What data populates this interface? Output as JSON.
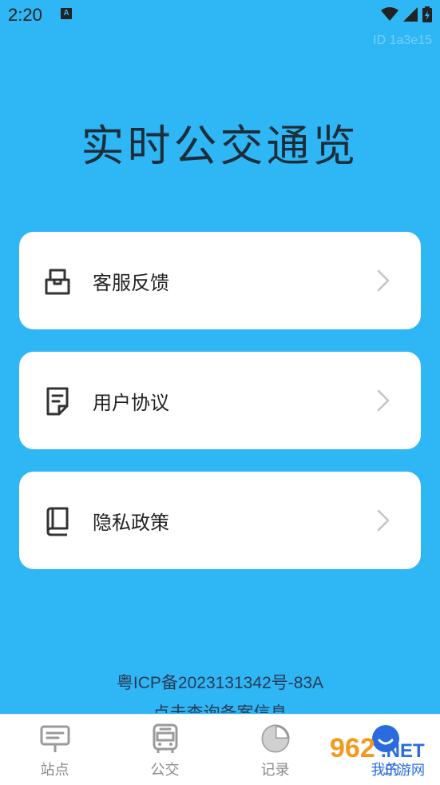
{
  "status_bar": {
    "time": "2:20",
    "badge": "A",
    "icons": [
      "wifi-icon",
      "signal-icon",
      "battery-charging-icon"
    ]
  },
  "id_text": "ID 1a3e15",
  "app_title": "实时公交通览",
  "menu": [
    {
      "label": "客服反馈",
      "icon": "mailbox-icon"
    },
    {
      "label": "用户协议",
      "icon": "document-icon"
    },
    {
      "label": "隐私政策",
      "icon": "book-icon"
    }
  ],
  "icp": "粤ICP备2023131342号-83A",
  "icp_sub": "点击查询备案信息",
  "tabs": [
    {
      "label": "站点",
      "icon": "station-sign-icon"
    },
    {
      "label": "公交",
      "icon": "bus-icon"
    },
    {
      "label": "记录",
      "icon": "pie-chart-icon"
    },
    {
      "label": "我的",
      "icon": "smiley-icon",
      "active": true
    }
  ],
  "watermark": {
    "brand": "962",
    "suffix": ".NET",
    "site": "乐游网"
  },
  "colors": {
    "background": "#2eb6f5",
    "card": "#ffffff",
    "title": "#1e2d3a",
    "tab_active": "#2a6be0",
    "tab_inactive": "#8a8a8a"
  }
}
